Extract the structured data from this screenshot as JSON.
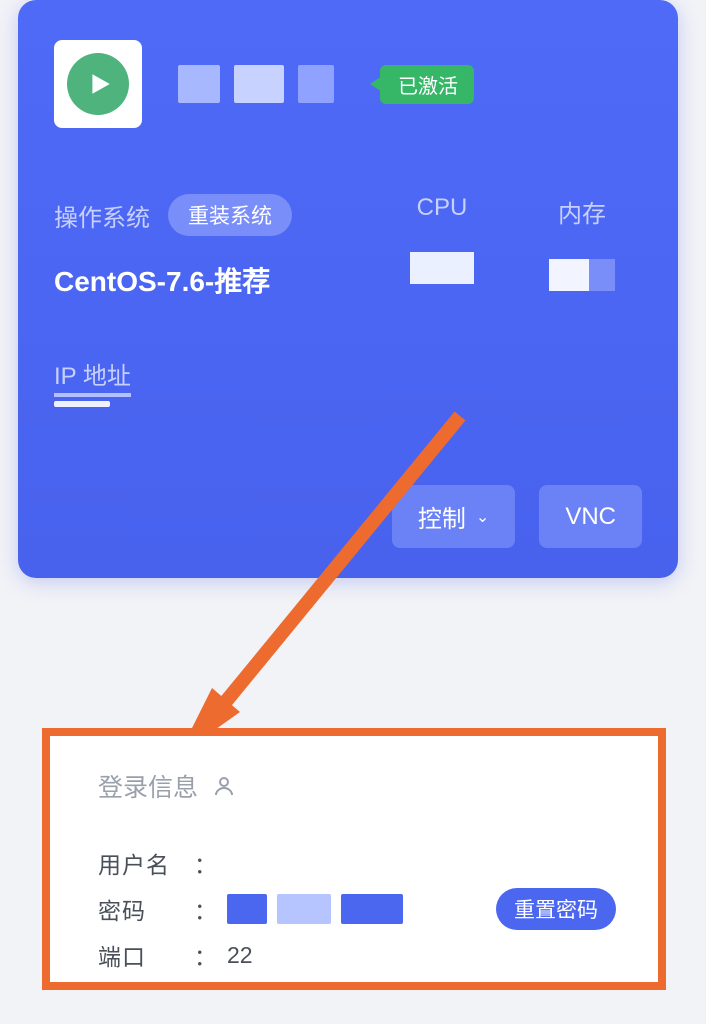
{
  "card": {
    "status_badge": "已激活",
    "os_label": "操作系统",
    "reinstall_label": "重装系统",
    "os_value": "CentOS-7.6-推荐",
    "cpu_label": "CPU",
    "mem_label": "内存",
    "ip_label": "IP 地址",
    "control_btn": "控制",
    "vnc_btn": "VNC"
  },
  "login": {
    "title": "登录信息",
    "username_label": "用户名",
    "password_label": "密码",
    "port_label": "端口",
    "port_value": "22",
    "reset_btn": "重置密码"
  }
}
